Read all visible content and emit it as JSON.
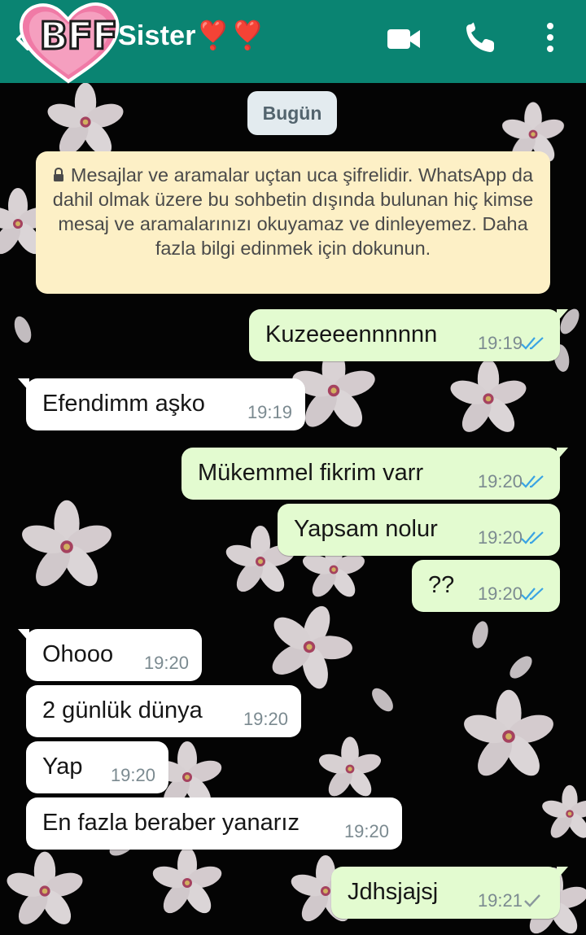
{
  "header": {
    "avatar_text": "BFF",
    "contact_name": "Sister❣️❣️",
    "back_icon": "chevron-left-icon",
    "video_icon": "video-camera-icon",
    "call_icon": "phone-icon",
    "menu_icon": "more-vertical-icon",
    "accent_color": "#0a8472"
  },
  "date_chip": "Bugün",
  "encryption_notice": "Mesajlar ve aramalar uçtan uca şifrelidir. WhatsApp da dahil olmak üzere bu sohbetin dışında bulunan hiç kimse mesaj ve aramalarınızı okuyamaz ve dinleyemez. Daha fazla bilgi edinmek için dokunun.",
  "messages": [
    {
      "direction": "out",
      "text": "Kuzeeeennnnnn",
      "time": "19:19",
      "status": "read"
    },
    {
      "direction": "in",
      "text": "Efendimm aşko",
      "time": "19:19"
    },
    {
      "direction": "out",
      "text": "Mükemmel fikrim varr",
      "time": "19:20",
      "status": "read"
    },
    {
      "direction": "out",
      "text": "Yapsam nolur",
      "time": "19:20",
      "status": "read"
    },
    {
      "direction": "out",
      "text": "??",
      "time": "19:20",
      "status": "read"
    },
    {
      "direction": "in",
      "text": "Ohooo",
      "time": "19:20"
    },
    {
      "direction": "in",
      "text": "2 günlük dünya",
      "time": "19:20"
    },
    {
      "direction": "in",
      "text": "Yap",
      "time": "19:20"
    },
    {
      "direction": "in",
      "text": "En fazla beraber yanarız",
      "time": "19:20"
    },
    {
      "direction": "out",
      "text": "Jdhsjajsj",
      "time": "19:21",
      "status": "sent"
    }
  ],
  "colors": {
    "outgoing_bubble": "#e3fbd0",
    "incoming_bubble": "#ffffff",
    "read_tick": "#3aa3e3",
    "sent_tick": "#8a979c",
    "notice_bg": "#fdf0c6"
  }
}
